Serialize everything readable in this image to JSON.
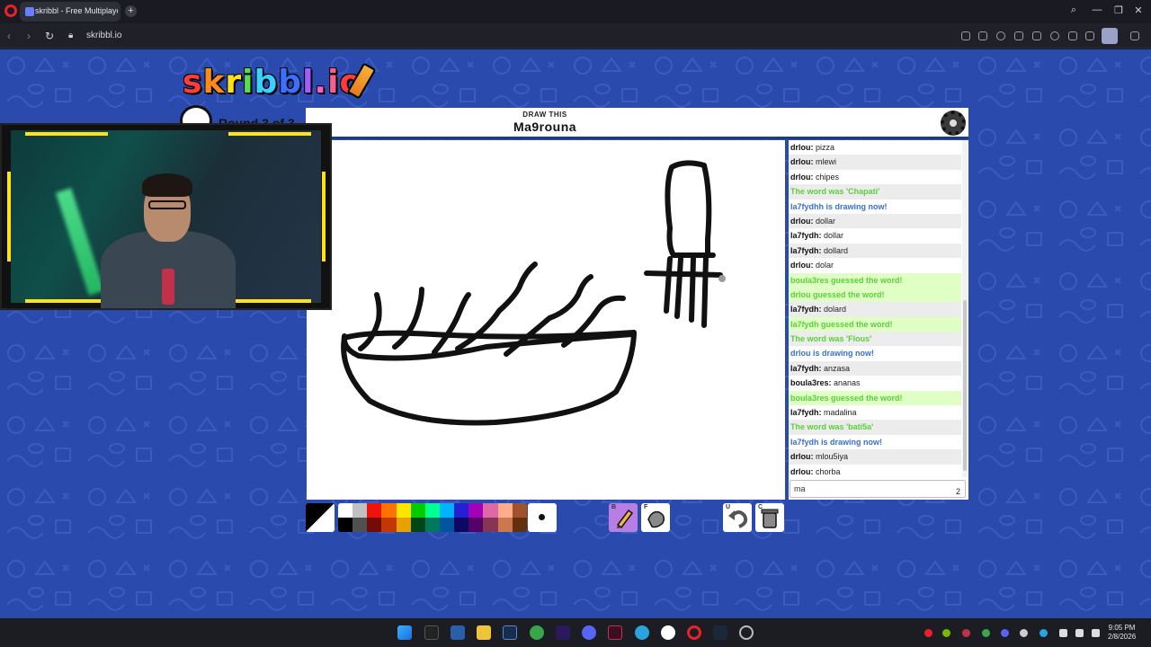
{
  "browser": {
    "tab_title": "skribbl - Free Multiplayer",
    "url": "skribbl.io",
    "new_tab_label": "+"
  },
  "game": {
    "logo_text": "skribbl.io",
    "logo_letters": [
      {
        "ch": "s",
        "color": "#ff3b3b"
      },
      {
        "ch": "k",
        "color": "#ff8a1c"
      },
      {
        "ch": "r",
        "color": "#ffe21a"
      },
      {
        "ch": "i",
        "color": "#4fe34f"
      },
      {
        "ch": "b",
        "color": "#3ad1ff"
      },
      {
        "ch": "b",
        "color": "#3a6fff"
      },
      {
        "ch": "l",
        "color": "#a35cff"
      },
      {
        "ch": ".",
        "color": "#ff5cc9"
      },
      {
        "ch": "i",
        "color": "#ff5c8a"
      },
      {
        "ch": "o",
        "color": "#ff3b3b"
      }
    ],
    "round_label": "Round 3 of 3",
    "draw_this_label": "DRAW THIS",
    "word": "Ma9rouna"
  },
  "chat": {
    "messages": [
      {
        "kind": "normal",
        "who": "drlou:",
        "text": "pizza"
      },
      {
        "kind": "normal",
        "who": "drlou:",
        "text": "mlewi"
      },
      {
        "kind": "normal",
        "who": "drlou:",
        "text": "chipes"
      },
      {
        "kind": "word",
        "who": "",
        "text": "The word was 'Chapati'"
      },
      {
        "kind": "draw",
        "who": "",
        "text": "la7fydhh is drawing now!"
      },
      {
        "kind": "normal",
        "who": "drlou:",
        "text": "dollar"
      },
      {
        "kind": "normal",
        "who": "la7fydh:",
        "text": "dollar"
      },
      {
        "kind": "normal",
        "who": "la7fydh:",
        "text": "dollard"
      },
      {
        "kind": "normal",
        "who": "drlou:",
        "text": "dolar"
      },
      {
        "kind": "guess",
        "who": "",
        "text": "boula3res guessed the word!"
      },
      {
        "kind": "guess",
        "who": "",
        "text": "drlou guessed the word!"
      },
      {
        "kind": "normal",
        "who": "la7fydh:",
        "text": "dolard"
      },
      {
        "kind": "guess",
        "who": "",
        "text": "la7fydh guessed the word!"
      },
      {
        "kind": "word",
        "who": "",
        "text": "The word was 'Flous'"
      },
      {
        "kind": "draw",
        "who": "",
        "text": "drlou is drawing now!"
      },
      {
        "kind": "normal",
        "who": "la7fydh:",
        "text": "anzasa"
      },
      {
        "kind": "normal",
        "who": "boula3res:",
        "text": "ananas"
      },
      {
        "kind": "guess",
        "who": "",
        "text": "boula3res guessed the word!"
      },
      {
        "kind": "normal",
        "who": "la7fydh:",
        "text": "madalina"
      },
      {
        "kind": "word",
        "who": "",
        "text": "The word was 'bati5a'"
      },
      {
        "kind": "draw",
        "who": "",
        "text": "la7fydh is drawing now!"
      },
      {
        "kind": "normal",
        "who": "drlou:",
        "text": "mlou5iya"
      },
      {
        "kind": "normal",
        "who": "drlou:",
        "text": "chorba"
      }
    ],
    "input_value": "ma",
    "char_count": "2"
  },
  "toolbar": {
    "palette": [
      "#ffffff",
      "#c1c1c1",
      "#ef130b",
      "#ff7100",
      "#ffe400",
      "#00cc00",
      "#00ff91",
      "#00b2ff",
      "#231fd3",
      "#a300ba",
      "#df69a7",
      "#ffac8e",
      "#a0522d",
      "#000000",
      "#505050",
      "#740b07",
      "#c23800",
      "#e8a200",
      "#004619",
      "#00785d",
      "#00569e",
      "#0e0865",
      "#550069",
      "#873554",
      "#cc774d",
      "#63300d"
    ],
    "pen_key": "B",
    "fill_key": "F",
    "undo_key": "U",
    "clear_key": "C"
  },
  "taskbar": {
    "time": "9:05 PM",
    "date": "2/8/2026"
  }
}
